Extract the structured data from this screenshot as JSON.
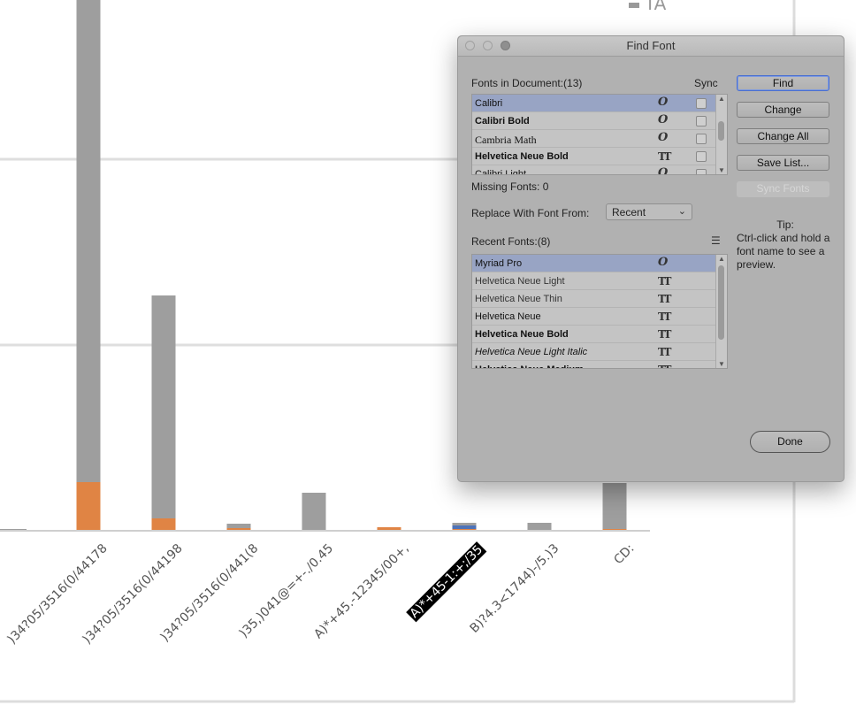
{
  "chart_data": {
    "type": "bar",
    "categories": [
      ")34?05/3516(0/44178",
      ")34?05/3516(0/44198",
      ")34?05/3516(0/441(8",
      ")35,)041@=+-./0.45",
      "A)*+45.-12345/00+,",
      "A)*+45-1:+;/35",
      "B)?4.3<1744)-/5.)3",
      "CD:"
    ],
    "selected_category_index": 5,
    "series": [
      {
        "name": "",
        "color": "#e08444",
        "values": [
          55,
          14,
          3,
          0,
          4,
          2,
          0,
          2
        ]
      },
      {
        "name": "",
        "color": "#4e73b8",
        "values": [
          0,
          0,
          0,
          0,
          0,
          4,
          0,
          0
        ]
      },
      {
        "name": "TA",
        "color": "#9e9e9e",
        "values": [
          1220,
          252,
          5,
          43,
          0,
          3,
          9,
          52
        ]
      }
    ],
    "grid_lines_y": [
      210,
      420
    ],
    "ylim": [
      0,
      600
    ],
    "legend_visible_entry": "TA"
  },
  "dialog": {
    "title": "Find Font",
    "fonts_in_document_label": "Fonts in Document:(13)",
    "sync_header": "Sync",
    "document_fonts": [
      {
        "name": "Calibri",
        "icon": "O",
        "style": "normal",
        "selected": true
      },
      {
        "name": "Calibri Bold",
        "icon": "O",
        "style": "bold",
        "selected": false
      },
      {
        "name": "Cambria Math",
        "icon": "O",
        "style": "serif",
        "selected": false
      },
      {
        "name": "Helvetica Neue Bold",
        "icon": "TT",
        "style": "bold",
        "selected": false
      },
      {
        "name": "Calibri Light",
        "icon": "O",
        "style": "normal",
        "selected": false
      }
    ],
    "missing_fonts": "Missing Fonts: 0",
    "replace_label": "Replace With Font From:",
    "replace_value": "Recent",
    "recent_fonts_label": "Recent Fonts:(8)",
    "recent_fonts": [
      {
        "name": "Myriad Pro",
        "icon": "O",
        "style": "normal",
        "selected": true
      },
      {
        "name": "Helvetica Neue Light",
        "icon": "TT",
        "style": "light",
        "selected": false
      },
      {
        "name": "Helvetica Neue Thin",
        "icon": "TT",
        "style": "light",
        "selected": false
      },
      {
        "name": "Helvetica Neue",
        "icon": "TT",
        "style": "normal",
        "selected": false
      },
      {
        "name": "Helvetica Neue Bold",
        "icon": "TT",
        "style": "bold",
        "selected": false
      },
      {
        "name": "Helvetica Neue Light Italic",
        "icon": "TT",
        "style": "italic",
        "selected": false
      },
      {
        "name": "Helvetica Neue Medium",
        "icon": "TT",
        "style": "bold",
        "selected": false
      }
    ],
    "buttons": {
      "find": "Find",
      "change": "Change",
      "change_all": "Change All",
      "save_list": "Save List...",
      "sync_fonts": "Sync Fonts",
      "done": "Done"
    },
    "tip_title": "Tip:",
    "tip_body": "Ctrl-click and hold a font name to see a preview."
  }
}
